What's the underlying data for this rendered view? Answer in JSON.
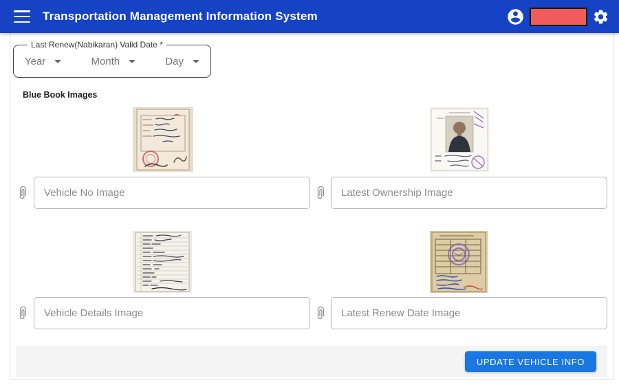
{
  "header": {
    "title": "Transportation Management Information System",
    "colors": {
      "background": "#1543c4",
      "redaction_fill": "#f25b5b"
    }
  },
  "form": {
    "date_fieldset": {
      "legend": "Last Renew(Nabikaran) Valid Date *",
      "selects": [
        {
          "label": "Year"
        },
        {
          "label": "Month"
        },
        {
          "label": "Day"
        }
      ]
    },
    "section_label": "Blue Book Images",
    "uploads": [
      {
        "placeholder": "Vehicle No Image"
      },
      {
        "placeholder": "Latest Ownership Image"
      },
      {
        "placeholder": "Vehicle Details Image"
      },
      {
        "placeholder": "Latest Renew Date Image"
      }
    ]
  },
  "footer": {
    "update_button_label": "UPDATE VEHICLE INFO",
    "button_color": "#1877e0"
  }
}
